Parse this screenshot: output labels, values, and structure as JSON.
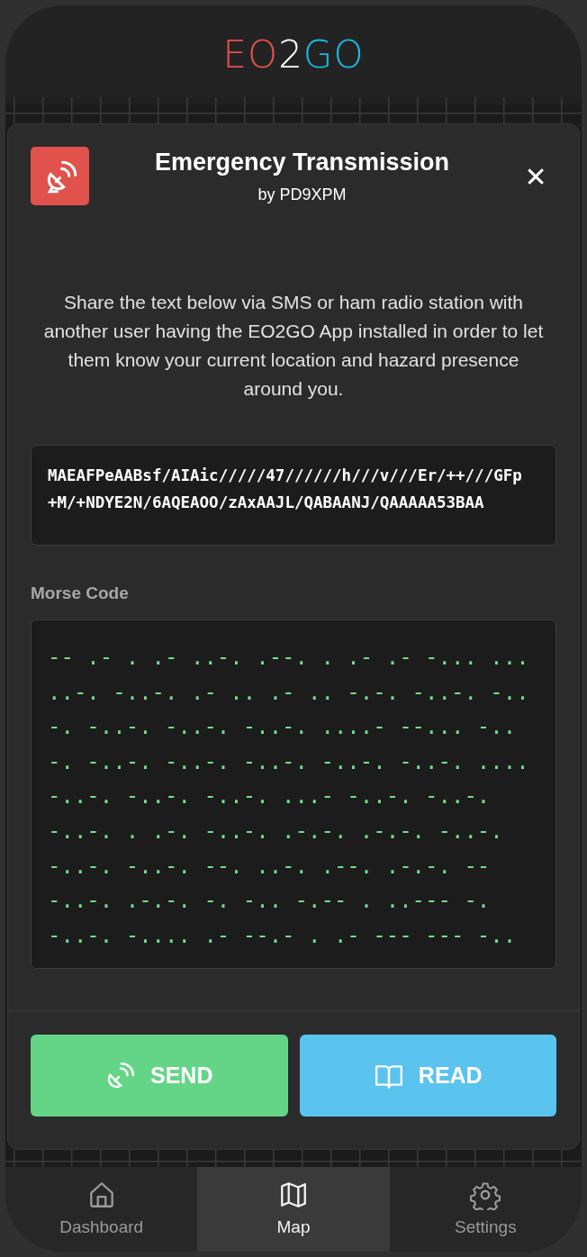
{
  "logo": [
    {
      "text": "EO",
      "color": "#e0524b"
    },
    {
      "text": "2",
      "color": "#ffffff"
    },
    {
      "text": "GO",
      "color": "#1ab8e6"
    }
  ],
  "dialog": {
    "title": "Emergency Transmission",
    "subtitle": "by PD9XPM",
    "close": "✕",
    "description": "Share the text below via SMS or ham radio station with another user having the EO2GO App installed in order to let them know your current location and hazard presence around you.",
    "code_lines": [
      "MAEAFPeAABsf/AIAic/////47//////h///v///Er/++///GFp",
      "+M/+NDYE2N/6AQEAOO/zAxAAJL/QABAANJ/QAAAAA53BAA"
    ],
    "morse_label": "Morse Code",
    "morse_lines": [
      "-- .- . .- ..-. .--. . .- .- -... ...",
      "..-. -..-. .- .. .- .. -.-. -..-. -..",
      "-. -..-. -..-. -..-. ....- --... -..",
      "-. -..-. -..-. -..-. -..-. -..-. ....",
      "-..-. -..-. -..-. ...- -..-. -..-.",
      "-..-. . .-. -..-. .-.-. .-.-. -..-.",
      "-..-. -..-. --. ..-. .--. .-.-. --",
      "-..-. .-.-. -. -.. -.-- . ..--- -.",
      "-..-. -.... .- --.- . .- --- --- -.."
    ],
    "buttons": [
      {
        "kind": "send",
        "label": "SEND"
      },
      {
        "kind": "read",
        "label": "READ"
      }
    ]
  },
  "nav": [
    {
      "kind": "home",
      "label": "Dashboard",
      "selected": false
    },
    {
      "kind": "map",
      "label": "Map",
      "selected": true
    },
    {
      "kind": "settings",
      "label": "Settings",
      "selected": false
    }
  ]
}
